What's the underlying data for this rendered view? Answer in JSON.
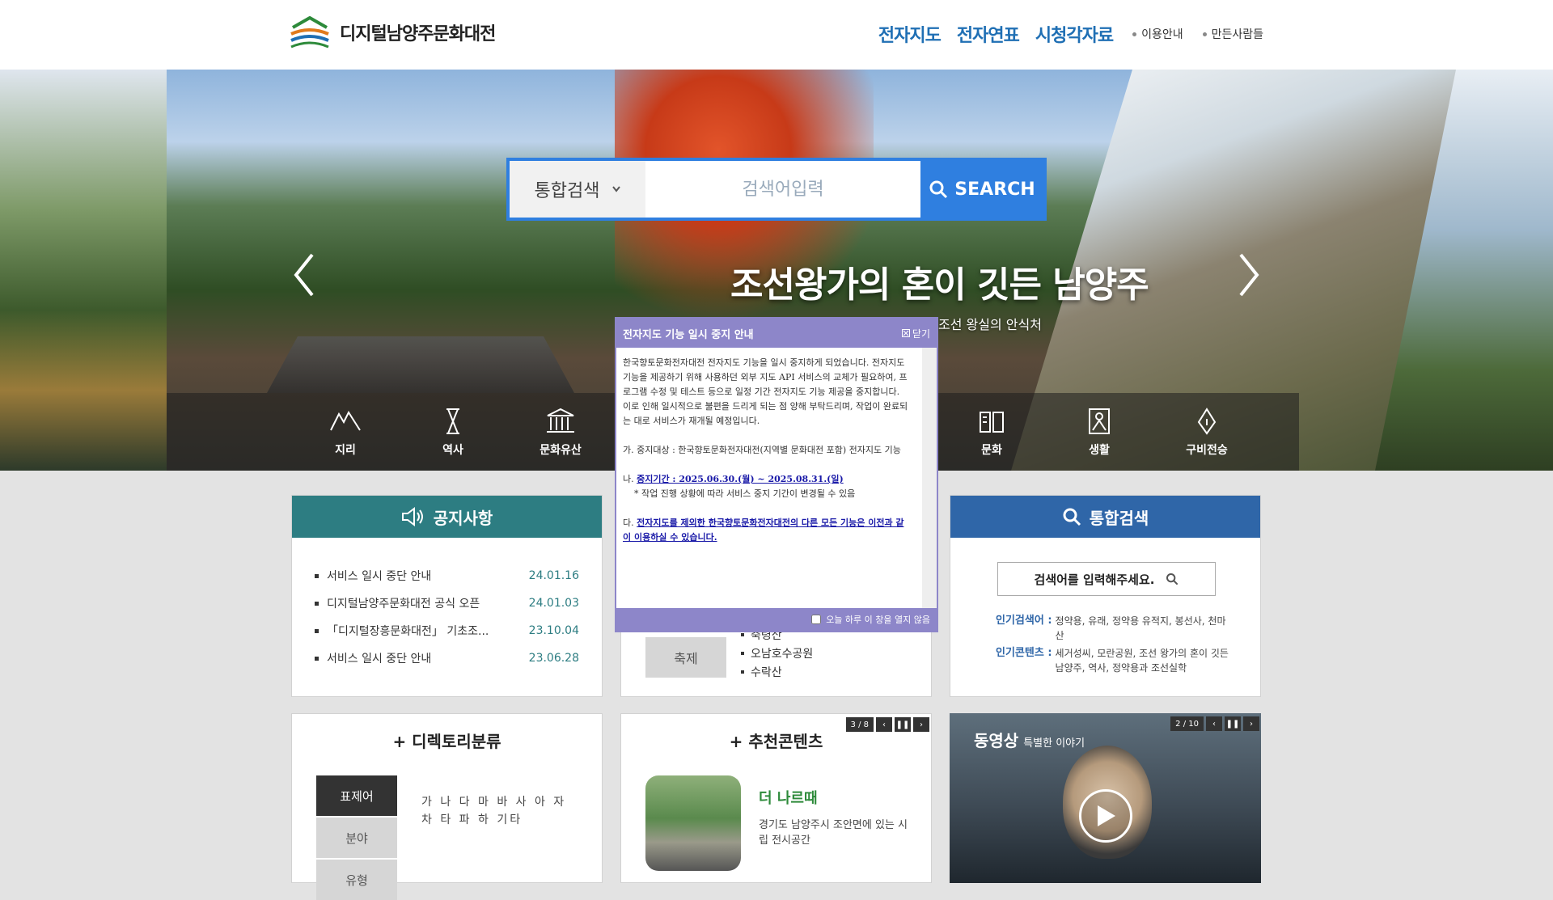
{
  "header": {
    "site_title": "디지털남양주문화대전",
    "nav_main": [
      "전자지도",
      "전자연표",
      "시청각자료"
    ],
    "nav_sub": [
      "이용안내",
      "만든사람들"
    ]
  },
  "hero": {
    "search": {
      "select_value": "통합검색",
      "placeholder": "검색어입력",
      "button_label": "SEARCH"
    },
    "title": "조선왕가의 혼이 깃든 남양주",
    "subtitle": "조선 왕실의 안식처",
    "categories": [
      "지리",
      "역사",
      "문화유산",
      "문화",
      "생활",
      "구비전승"
    ]
  },
  "notice": {
    "title": "공지사항",
    "items": [
      {
        "text": "서비스 일시 중단 안내",
        "date": "24.01.16"
      },
      {
        "text": "디지털남양주문화대전 공식 오픈",
        "date": "24.01.03"
      },
      {
        "text": "「디지털장흥문화대전」 기초조...",
        "date": "23.10.04"
      },
      {
        "text": "서비스 일시 중단 안내",
        "date": "23.06.28"
      }
    ]
  },
  "festival": {
    "tag": "축제",
    "items": [
      "축령산",
      "오남호수공원",
      "수락산"
    ]
  },
  "total_search": {
    "title": "통합검색",
    "input_placeholder": "검색어를 입력해주세요.",
    "popular_keywords_label": "인기검색어 :",
    "popular_keywords": "정약용, 유래, 정약용 유적지, 봉선사, 천마산",
    "popular_contents_label": "인기콘텐츠 :",
    "popular_contents": "세거성씨, 모란공원, 조선 왕가의 혼이 깃든 남양주, 역사, 정약용과 조선실학"
  },
  "directory": {
    "title": "+ 디렉토리분류",
    "tabs": [
      "표제어",
      "분야",
      "유형"
    ],
    "letters": "가 나 다 마 바 사 아 자 차 타 파 하 기타"
  },
  "recommend": {
    "title": "+ 추천콘텐츠",
    "page": "3 / 8",
    "name": "더 나르때",
    "desc": "경기도 남양주시 조안면에 있는 시립 전시공간"
  },
  "video": {
    "title": "동영상",
    "subtitle": "특별한 이야기",
    "page": "2 / 10"
  },
  "popup": {
    "title": "전자지도 기능 일시 중지 안내",
    "close_label": "닫기",
    "para1": "한국향토문화전자대전 전자지도 기능을 일시 중지하게 되었습니다. 전자지도 기능을 제공하기 위해 사용하던 외부 지도 API 서비스의 교체가 필요하여, 프로그램 수정 및 테스트 등으로 일정 기간 전자지도 기능 제공을 중지합니다.",
    "para2": "이로 인해 일시적으로 불편을 드리게 되는 점 양해 부탁드리며, 작업이 완료되는 대로 서비스가 재개될 예정입니다.",
    "item_ga": "가. 중지대상 : 한국향토문화전자대전(지역별 문화대전 포함) 전자지도 기능",
    "item_na_prefix": "나.",
    "item_na": "중지기간 : 2025.06.30.(월) ~ 2025.08.31.(일)",
    "item_na_note": "* 작업 진행 상황에 따라 서비스 중지 기간이 변경될 수 있음",
    "item_da_prefix": "다.",
    "item_da": "전자지도를 제외한 한국향토문화전자대전의 다른 모든 기능은 이전과 같이 이용하실 수 있습니다.",
    "footer_label": "오늘 하루 이 창을 열지 않음"
  },
  "colors": {
    "brand_blue": "#2f7fe0",
    "notice_teal": "#2d7d82",
    "search_blue": "#2f66a8",
    "popup_purple": "#8d86c9"
  }
}
